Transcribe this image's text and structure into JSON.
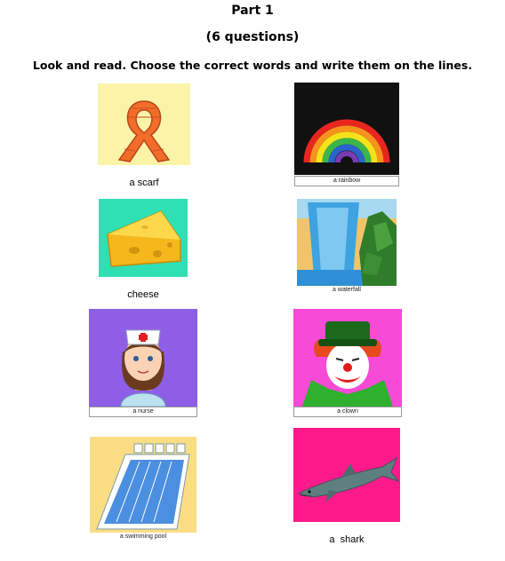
{
  "header": {
    "part": "Part 1",
    "questions": "(6 questions)",
    "instruction": "Look and read. Choose the correct words and write them on the lines."
  },
  "pictures": [
    {
      "id": "scarf",
      "label": "a scarf"
    },
    {
      "id": "rainbow",
      "label": "a rainbow"
    },
    {
      "id": "cheese",
      "label": "cheese"
    },
    {
      "id": "waterfall",
      "label": "a waterfall"
    },
    {
      "id": "nurse",
      "label": "a nurse"
    },
    {
      "id": "clown",
      "label": "a clown"
    },
    {
      "id": "swimming-pool",
      "label": "a swimming pool"
    },
    {
      "id": "shark",
      "label": "a  shark"
    }
  ],
  "colors": {
    "scarf_bg": "#fbf3a8",
    "cheese_bg": "#2fe0b4",
    "nurse_bg": "#8e5ee6",
    "clown_bg": "#f74ad7",
    "shark_bg": "#ff1a8c",
    "pool_bg": "#fbdd84"
  }
}
